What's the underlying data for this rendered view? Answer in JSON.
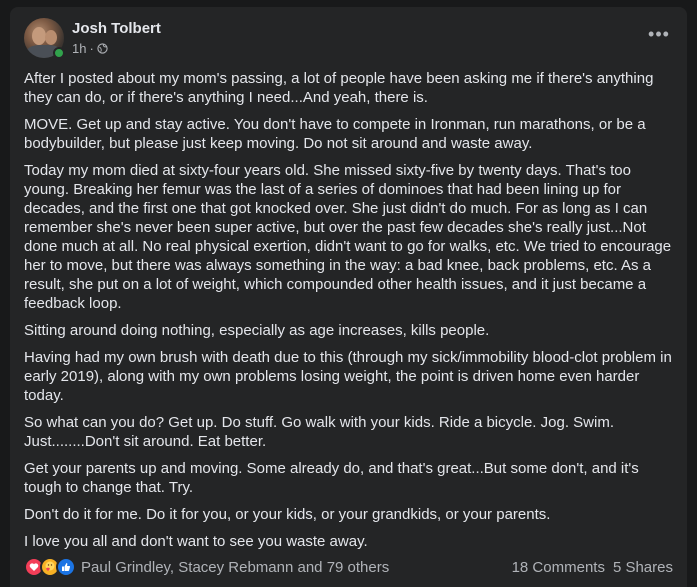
{
  "post": {
    "author": "Josh Tolbert",
    "time": "1h",
    "separator": "·",
    "paragraphs": [
      "After I posted about my mom's passing, a lot of people have been asking me if there's anything they can do, or if there's anything I need...And yeah, there is.",
      "MOVE. Get up and stay active. You don't have to compete in Ironman, run marathons, or be a bodybuilder, but please just keep moving. Do not sit around and waste away.",
      "Today my mom died at sixty-four years old. She missed sixty-five by twenty days. That's too young. Breaking her femur was the last of a series of dominoes that had been lining up for decades, and the first one that got knocked over. She just didn't do much. For as long as I can remember she's never been super active, but over the past few decades she's really just...Not done much at all. No real physical exertion, didn't want to go for walks, etc. We tried to encourage her to move, but there was always something in the way: a bad knee, back problems, etc. As a result, she put on a lot of weight, which compounded other health issues, and it just became a feedback loop.",
      "Sitting around doing nothing, especially as age increases, kills people.",
      "Having had my own brush with death due to this (through my sick/immobility blood-clot problem in early 2019), along with my own problems losing weight, the point is driven home even harder today.",
      "So what can you do? Get up. Do stuff. Go walk with your kids. Ride a bicycle. Jog. Swim. Just........Don't sit around. Eat better.",
      "Get your parents up and moving. Some already do, and that's great...But some don't, and it's tough to change that. Try.",
      "Don't do it for me. Do it for you, or your kids, or your grandkids, or your parents.",
      "I love you all and don't want to see you waste away."
    ]
  },
  "footer": {
    "reaction_icons": [
      "love-icon",
      "care-icon",
      "like-icon"
    ],
    "reaction_names": "Paul Grindley, Stacey Rebmann and 79 others",
    "comments": "18 Comments",
    "shares": "5 Shares"
  },
  "colors": {
    "background": "#18191a",
    "card": "#242526",
    "text": "#e4e6eb",
    "secondary": "#b0b3b8",
    "online": "#31a24c",
    "love": "#f33e58",
    "care": "#f7b125",
    "like": "#1b74e4"
  }
}
